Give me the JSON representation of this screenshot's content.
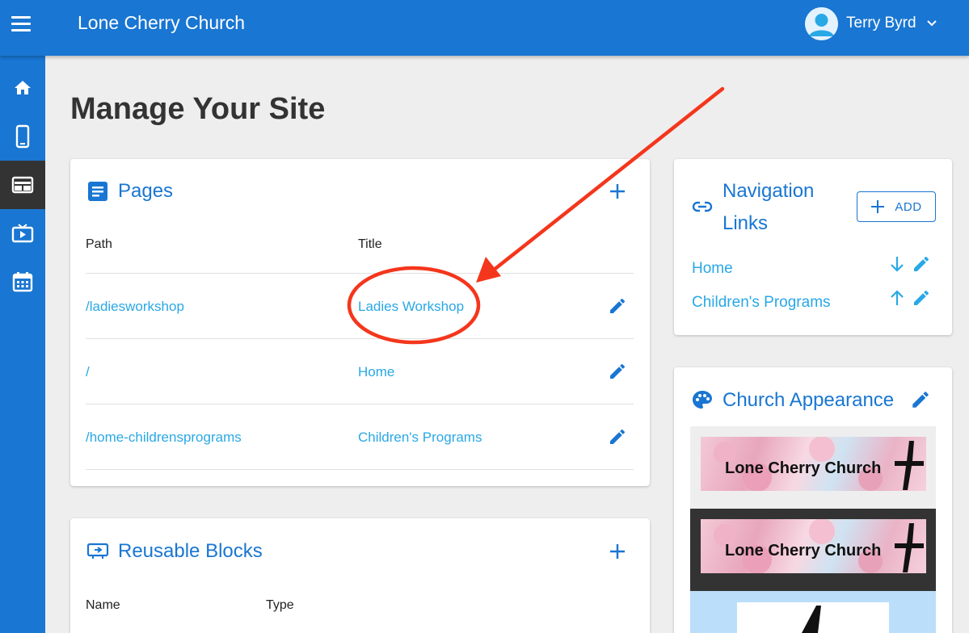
{
  "app": {
    "title": "Lone Cherry Church",
    "user_name": "Terry Byrd"
  },
  "sidebar": {
    "items": [
      {
        "icon": "home-icon"
      },
      {
        "icon": "mobile-icon"
      },
      {
        "icon": "web-icon",
        "active": true
      },
      {
        "icon": "tv-icon"
      },
      {
        "icon": "calendar-icon"
      }
    ]
  },
  "main": {
    "title": "Manage Your Site",
    "pages": {
      "title": "Pages",
      "columns": [
        "Path",
        "Title"
      ],
      "rows": [
        {
          "path": "/ladiesworkshop",
          "title": "Ladies Workshop"
        },
        {
          "path": "/",
          "title": "Home"
        },
        {
          "path": "/home-childrensprograms",
          "title": "Children's Programs"
        }
      ]
    },
    "blocks": {
      "title": "Reusable Blocks",
      "columns": [
        "Name",
        "Type"
      ]
    }
  },
  "nav_links": {
    "title_line1": "Navigation",
    "title_line2": "Links",
    "add_label": "ADD",
    "items": [
      {
        "label": "Home"
      },
      {
        "label": "Children's Programs"
      }
    ]
  },
  "appearance": {
    "title": "Church Appearance",
    "banner_text": "Lone Cherry Church"
  },
  "colors": {
    "primary": "#1976d2",
    "link": "#29a8e6",
    "annotation": "#f4361c"
  }
}
